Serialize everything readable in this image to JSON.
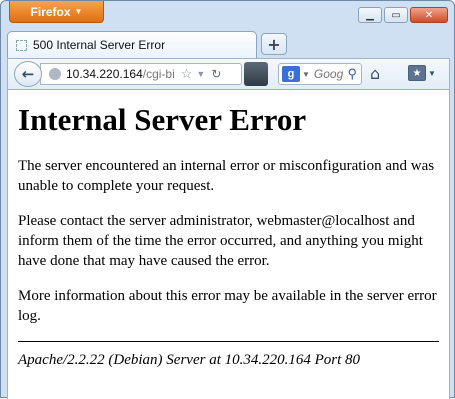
{
  "browser": {
    "menu_label": "Firefox",
    "window_controls": {
      "minimize": "▁",
      "maximize": "▭",
      "close": "✕"
    },
    "tab": {
      "title": "500 Internal Server Error"
    },
    "new_tab_label": "+",
    "url": {
      "host": "10.34.220.164",
      "path": "/cgi-bi"
    },
    "search": {
      "engine": "Google",
      "placeholder": "Goog"
    }
  },
  "page": {
    "heading": "Internal Server Error",
    "paragraphs": [
      "The server encountered an internal error or misconfiguration and was unable to complete your request.",
      "Please contact the server administrator, webmaster@localhost and inform them of the time the error occurred, and anything you might have done that may have caused the error.",
      "More information about this error may be available in the server error log."
    ],
    "footer": "Apache/2.2.22 (Debian) Server at 10.34.220.164 Port 80"
  },
  "icons": [
    "back-arrow-icon",
    "globe-icon",
    "star-icon",
    "reload-icon",
    "feed-icon",
    "google-icon",
    "search-icon",
    "home-icon",
    "bookmarks-icon"
  ]
}
